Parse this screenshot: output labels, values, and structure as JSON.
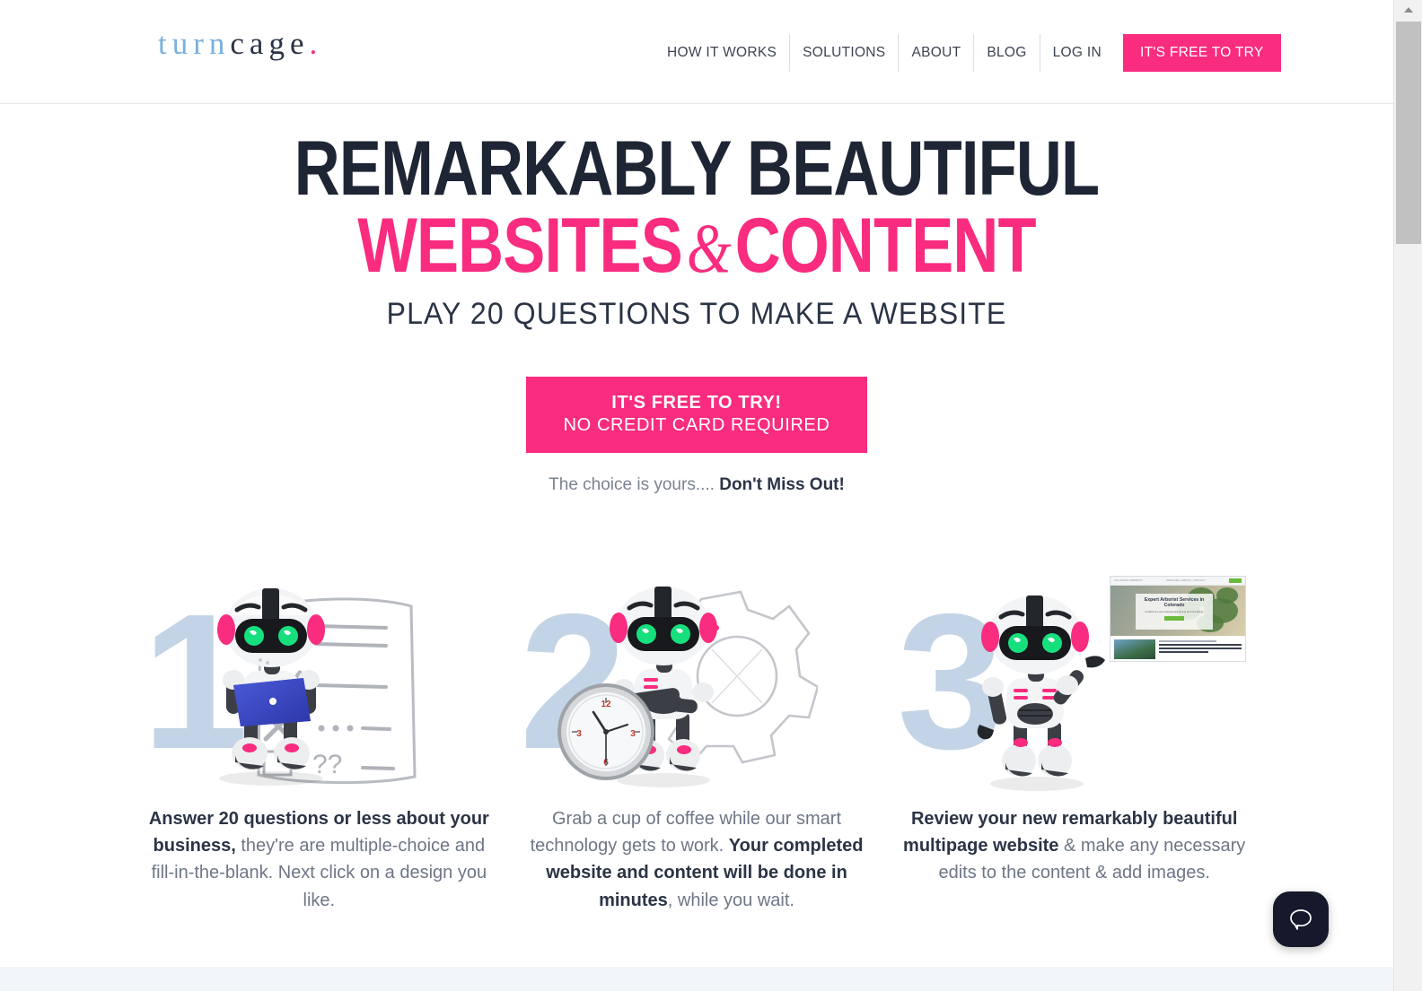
{
  "brand": {
    "logo_part1": "turn",
    "logo_part2": "cage",
    "logo_dot": ".",
    "accent_pink": "#F92C7F",
    "dark_navy": "#1E2534",
    "light_blue": "#C3D4E6"
  },
  "nav": {
    "items": [
      {
        "label": "HOW IT WORKS"
      },
      {
        "label": "SOLUTIONS"
      },
      {
        "label": "ABOUT"
      },
      {
        "label": "BLOG"
      },
      {
        "label": "LOG IN"
      }
    ],
    "cta_label": "IT'S FREE TO TRY"
  },
  "hero": {
    "headline_line1": "REMARKABLY BEAUTIFUL",
    "headline_line2_a": "WEBSITES",
    "headline_line2_amp": "&",
    "headline_line2_b": "CONTENT",
    "subheadline": "PLAY 20 QUESTIONS TO MAKE A WEBSITE",
    "cta_primary": "IT'S FREE TO TRY!",
    "cta_secondary": "NO CREDIT CARD REQUIRED",
    "tagline_normal": "The choice is yours....",
    "tagline_strong": "Don't Miss Out!"
  },
  "features": [
    {
      "number": "1",
      "caption_bold": "Answer 20 questions or less about your business,",
      "caption_rest": " they're are multiple-choice and fill-in-the-blank. Next click on a design you like."
    },
    {
      "number": "2",
      "caption_lead": "Grab a cup of coffee while our smart technology gets to work. ",
      "caption_bold": "Your completed website and content will be done in minutes",
      "caption_rest": ", while you wait."
    },
    {
      "number": "3",
      "caption_bold": "Review your new remarkably beautiful multipage website",
      "caption_rest": " & make any necessary edits to the content & add images."
    }
  ],
  "mockup": {
    "site_title": "Expert Arborist Services in Colorado",
    "site_sub": "Certified tree care professionals serving the Front Range",
    "nav_text": "COLORADO ARBORIST",
    "nav_links": "SERVICES  |  ABOUT  |  CONTACT",
    "button_label": "GET QUOTE",
    "body_text": "Trust the certified arborists at Colorado Arborist for expert tree care services.",
    "body_kicker": "Professional Tree Trimming & Removal"
  },
  "chat": {
    "icon": "speech-bubble-icon",
    "label": "Open chat"
  },
  "scrollbar": {
    "up_arrow": "scroll-up-arrow"
  }
}
